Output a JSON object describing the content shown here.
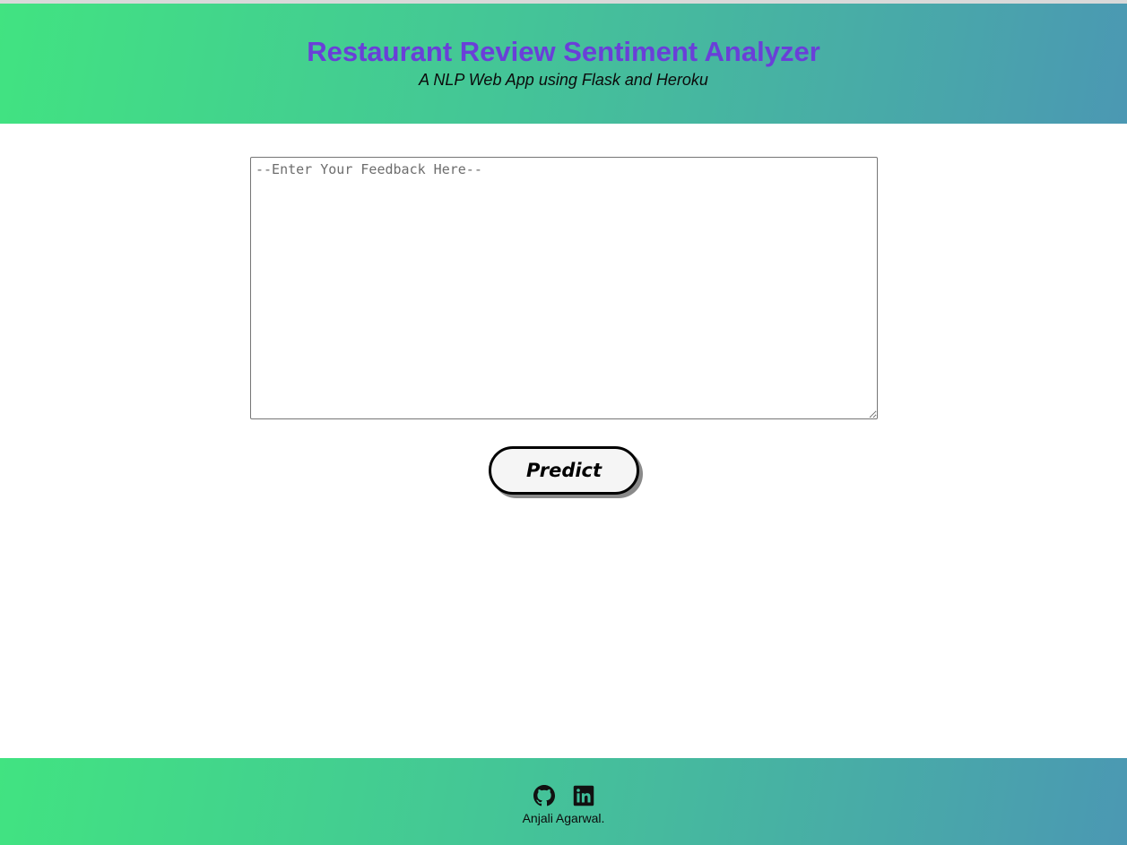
{
  "header": {
    "title": "Restaurant Review Sentiment Analyzer",
    "subtitle": "A NLP Web App using Flask and Heroku",
    "title_color": "#6a3fd8"
  },
  "form": {
    "feedback_placeholder": "--Enter Your Feedback Here--",
    "feedback_value": "",
    "predict_label": "Predict"
  },
  "footer": {
    "icons": [
      "github-icon",
      "linkedin-icon"
    ],
    "author": "Anjali Agarwal."
  },
  "colors": {
    "gradient_start": "#41e381",
    "gradient_end": "#4b98b3"
  }
}
